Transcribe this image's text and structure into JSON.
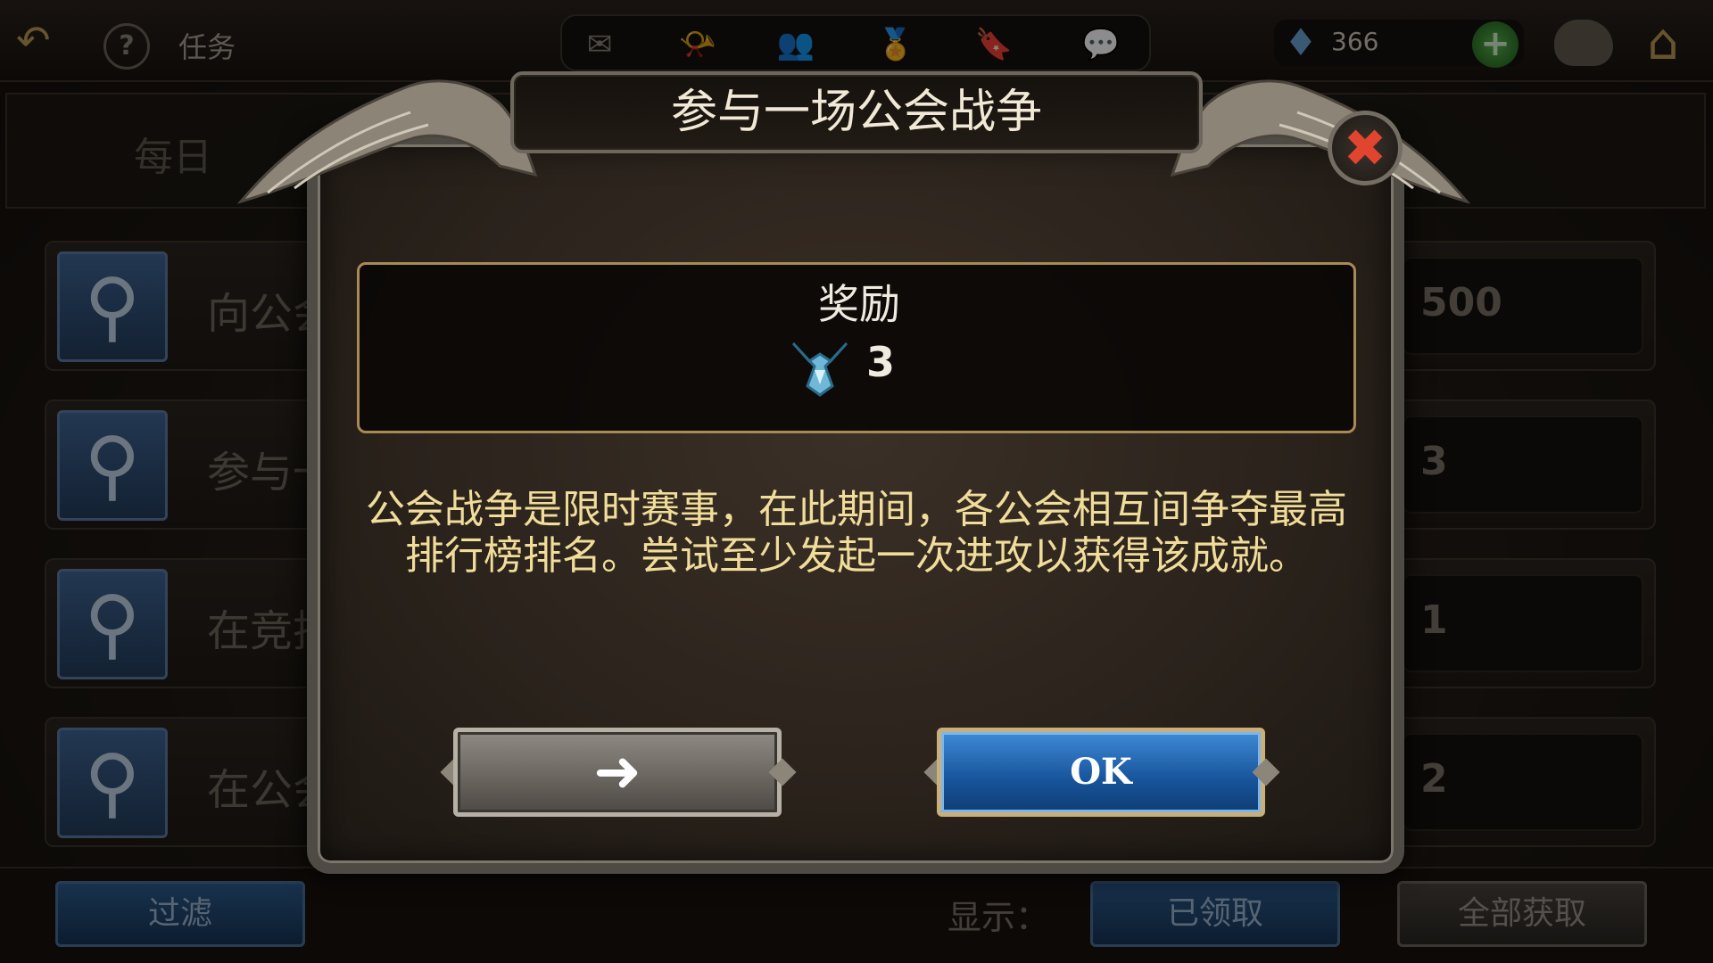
{
  "topbar": {
    "back_icon": "back-arrow-icon",
    "help_symbol": "?",
    "title": "任务",
    "icons": [
      "mail-icon",
      "horn-icon",
      "friends-icon",
      "medal-icon",
      "bookmark-icon",
      "chat-icon"
    ],
    "gem_count": "366",
    "gem_plus": "+"
  },
  "background": {
    "daily_tab": "每日",
    "rows": [
      {
        "text": "向公会",
        "value": "500"
      },
      {
        "text": "参与一",
        "value": "3"
      },
      {
        "text": "在竞技",
        "value": "1"
      },
      {
        "text": "在公会",
        "value": "2"
      }
    ],
    "bottom": {
      "filter_label": "过滤",
      "show_label": "显示：",
      "claimed_label": "已领取",
      "claim_all_label": "全部获取"
    }
  },
  "modal": {
    "title": "参与一场公会战争",
    "reward_label": "奖励",
    "reward_count": "3",
    "description": "公会战争是限时赛事，在此期间，各公会相互间争夺最高排行榜排名。尝试至少发起一次进攻以获得该成就。",
    "arrow_button": "➜",
    "ok_label": "OK",
    "close_symbol": "✖"
  },
  "colors": {
    "accent_gold": "#a88a54",
    "ok_blue": "#17549a",
    "desc_yellow": "#f1dd9a",
    "close_red": "#e1442f"
  }
}
